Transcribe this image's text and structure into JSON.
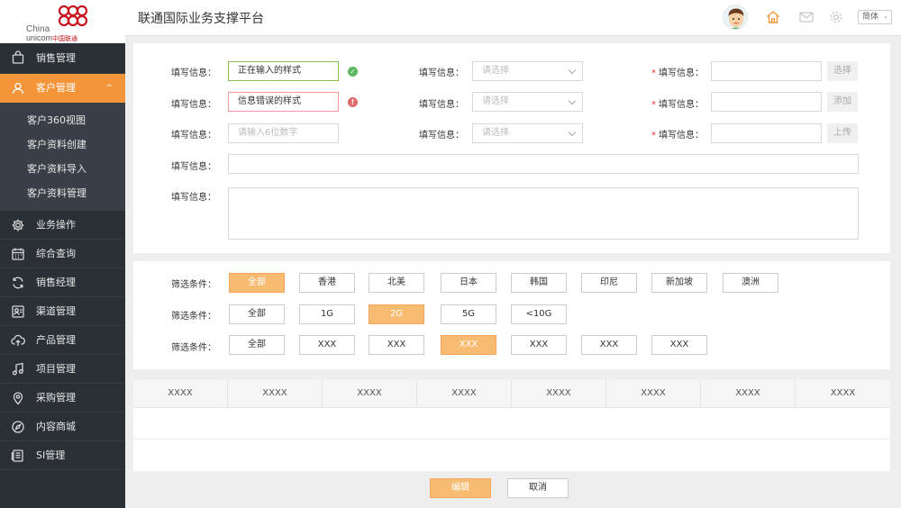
{
  "logo": {
    "line1": "China",
    "line2": "unicom",
    "line2_cn": "中国联通"
  },
  "header": {
    "title": "联通国际业务支撑平台",
    "lang": "简体"
  },
  "sidebar": {
    "items": [
      {
        "label": "销售管理",
        "icon": "shopping-bag-icon"
      },
      {
        "label": "客户管理",
        "icon": "user-icon",
        "active": true,
        "chevron": "^"
      },
      {
        "label": "业务操作",
        "icon": "gear-icon"
      },
      {
        "label": "综合查询",
        "icon": "calendar-icon"
      },
      {
        "label": "销售经理",
        "icon": "refresh-icon"
      },
      {
        "label": "渠道管理",
        "icon": "contact-card-icon"
      },
      {
        "label": "产品管理",
        "icon": "cloud-upload-icon"
      },
      {
        "label": "项目管理",
        "icon": "music-note-icon"
      },
      {
        "label": "采购管理",
        "icon": "location-pin-icon"
      },
      {
        "label": "内容商城",
        "icon": "compass-icon"
      },
      {
        "label": "SI管理",
        "icon": "document-list-icon"
      }
    ],
    "submenu": [
      "客户360视图",
      "客户资料创建",
      "客户资料导入",
      "客户资料管理"
    ]
  },
  "form": {
    "label": "填写信息：",
    "rows": [
      {
        "input_value": "正在输入的样式",
        "select_placeholder": "请选择",
        "button": "选择"
      },
      {
        "input_value": "信息错误的样式",
        "select_placeholder": "请选择",
        "button": "添加"
      },
      {
        "input_placeholder": "请输入6位数字",
        "select_placeholder": "请选择",
        "button": "上传"
      }
    ]
  },
  "filters": {
    "label": "筛选条件：",
    "rows": [
      [
        "全部",
        "香港",
        "北美",
        "日本",
        "韩国",
        "印尼",
        "新加坡",
        "澳洲"
      ],
      [
        "全部",
        "1G",
        "2G",
        "5G",
        "<10G"
      ],
      [
        "全部",
        "XXX",
        "XXX",
        "XXX",
        "XXX",
        "XXX",
        "XXX"
      ]
    ],
    "selected": [
      0,
      2,
      3
    ]
  },
  "table": {
    "headers": [
      "XXXX",
      "XXXX",
      "XXXX",
      "XXXX",
      "XXXX",
      "XXXX",
      "XXXX",
      "XXXX"
    ]
  },
  "actions": {
    "primary": "编辑",
    "secondary": "取消"
  },
  "colors": {
    "accent": "#f5953a",
    "sidebar": "#2b2f36",
    "selected_button": "#f8bb72",
    "required": "#e33333"
  }
}
